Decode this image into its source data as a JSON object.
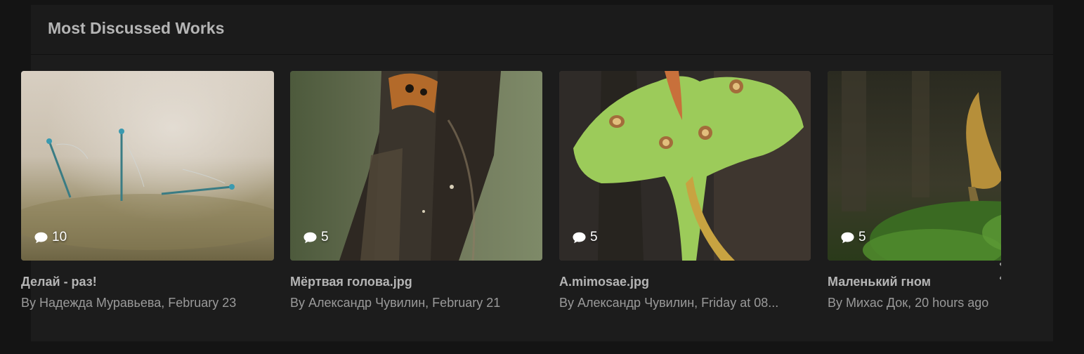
{
  "widget": {
    "title": "Most Discussed Works"
  },
  "cards": [
    {
      "title": "Делай - раз!",
      "meta": "By Надежда Муравьева, February 23",
      "comments": "10",
      "image": "damselflies-on-moss"
    },
    {
      "title": "Мёртвая голова.jpg",
      "meta": "By Александр Чувилин, February 21",
      "comments": "5",
      "image": "deaths-head-hawkmoth"
    },
    {
      "title": "A.mimosae.jpg",
      "meta": "By Александр Чувилин, Friday at 08...",
      "comments": "5",
      "image": "green-moon-moth"
    },
    {
      "title": "Маленький гном",
      "meta": "By Михас Док, 20 hours ago",
      "comments": "5",
      "image": "mushroom-in-moss"
    }
  ],
  "icons": {
    "comments": "comment-bubble-icon",
    "next": "chevron-right-icon"
  },
  "colors": {
    "page_bg": "#141414",
    "panel_bg": "#1c1c1c",
    "title": "#b5b5b5",
    "meta": "#9a9a9a"
  }
}
